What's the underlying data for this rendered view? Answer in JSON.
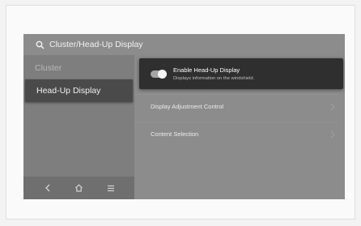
{
  "header": {
    "title": "Cluster/Head-Up Display",
    "icon": "search-icon"
  },
  "sidebar": {
    "items": [
      {
        "label": "Cluster",
        "selected": false
      },
      {
        "label": "Head-Up Display",
        "selected": true
      }
    ],
    "bottom_nav": [
      "back-icon",
      "home-icon",
      "menu-icon"
    ]
  },
  "main": {
    "rows": [
      {
        "title": "Enable Head-Up Display",
        "subtitle": "Displays information on the windshield.",
        "toggle_on": true
      },
      {
        "title": "Display Adjustment Control"
      },
      {
        "title": "Content Selection"
      }
    ]
  },
  "colors": {
    "screen_bg": "#8c8c8c",
    "selected_bg": "#4a4a4a",
    "highlight_row_bg": "#2f2f2f"
  }
}
